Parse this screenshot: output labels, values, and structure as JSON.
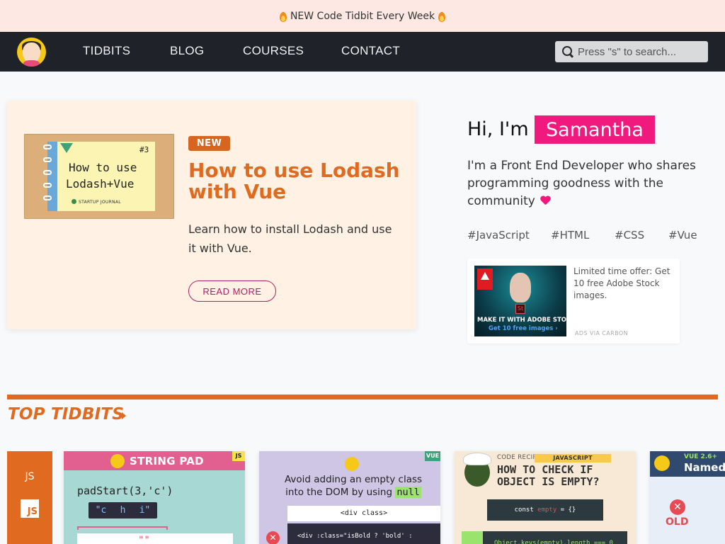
{
  "announcement": {
    "text": "NEW Code Tidbit Every Week"
  },
  "nav": {
    "links": [
      "TIDBITS",
      "BLOG",
      "COURSES",
      "CONTACT"
    ],
    "search_placeholder": "Press \"s\" to search..."
  },
  "hero": {
    "badge": "NEW",
    "title": "How to use Lodash with Vue",
    "description": "Learn how to install Lodash and use it with Vue.",
    "cta": "READ MORE",
    "thumbnail": {
      "number": "#3",
      "line1": "How to use",
      "line2": "Lodash+Vue",
      "brand": "STARTUP JOURNAL"
    }
  },
  "intro": {
    "greeting": "Hi, I'm",
    "name": "Samantha",
    "bio": "I'm a Front End Developer who shares programming goodness with the community",
    "tags": [
      "#JavaScript",
      "#HTML",
      "#CSS",
      "#Vue"
    ]
  },
  "ad": {
    "image_line1": "MAKE IT WITH ADOBE STOCK.",
    "image_line2": "Get 10 free images ›",
    "text": "Limited time offer: Get 10 free Adobe Stock images.",
    "via": "ADS VIA CARBON"
  },
  "section": {
    "title": "TOP TIDBITS"
  },
  "category_tab": {
    "label": "JS",
    "icon_text": "JS"
  },
  "cards": [
    {
      "title": "STRING PAD",
      "badge": "JS",
      "code": "padStart(3,'c')",
      "chars": [
        "\"c",
        "h",
        "i\""
      ],
      "output": "\"\""
    },
    {
      "badge": "VUE",
      "text_line1": "Avoid adding an empty class",
      "text_line2": "into the DOM by using",
      "highlight": "null",
      "box1": "<div class>",
      "box2": "<div :class=\"isBold ? 'bold' :"
    },
    {
      "label": "CODE RECIPE",
      "badge": "JAVASCRIPT",
      "title_line1": "HOW TO CHECK IF",
      "title_line2": "OBJECT IS EMPTY?",
      "code1_pre": "const ",
      "code1_var": "empty",
      "code1_post": " = {}",
      "code2": "Object.keys(empty).length === 0"
    },
    {
      "version": "VUE 2.6+",
      "title": "Named",
      "label": "OLD"
    }
  ],
  "colors": {
    "accent": "#e06a1f",
    "pink": "#f0197d",
    "nav_bg": "#1f2228",
    "banner_bg": "#fde8e4"
  }
}
